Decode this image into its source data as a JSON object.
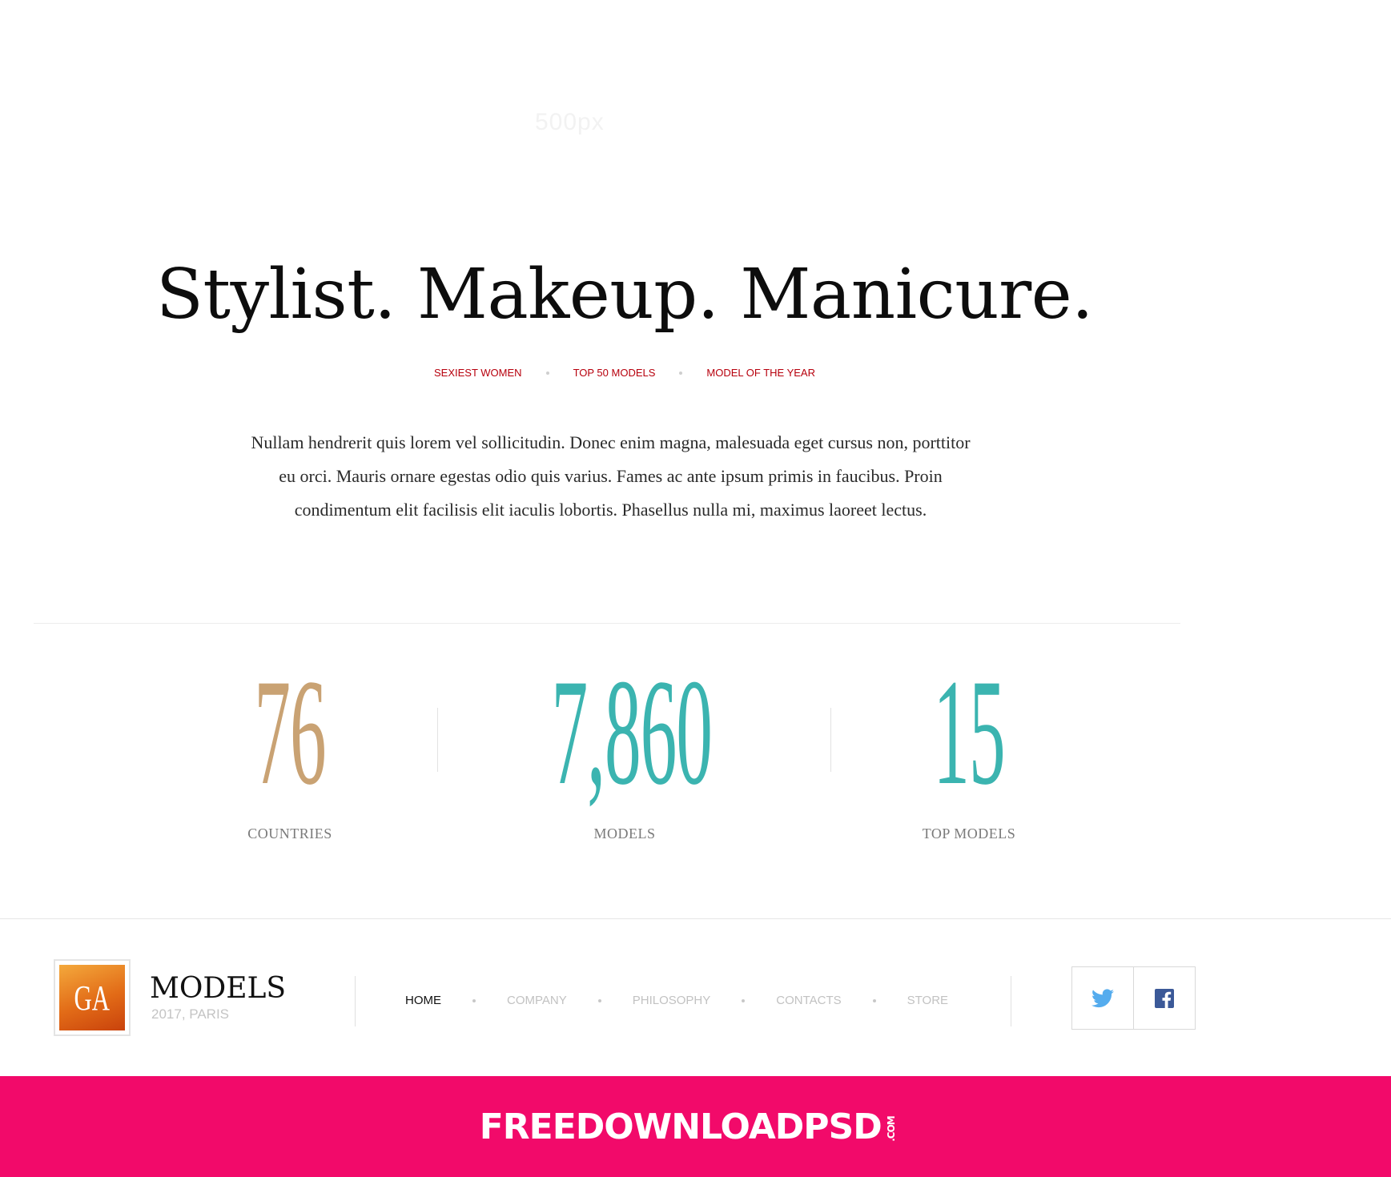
{
  "faint_logo": "500px",
  "hero": {
    "title": "Stylist. Makeup. Manicure."
  },
  "tags": [
    "SEXIEST WOMEN",
    "TOP 50 MODELS",
    "MODEL OF THE YEAR"
  ],
  "intro": "Nullam hendrerit quis lorem vel sollicitudin. Donec enim magna, malesuada eget cursus non, porttitor eu orci. Mauris ornare egestas odio quis varius. Fames ac ante ipsum primis in faucibus. Proin condimentum elit facilisis elit iaculis lobortis. Phasellus nulla mi, maximus laoreet lectus.",
  "stats": [
    {
      "number": "76",
      "label": "COUNTRIES",
      "color": "#c9a273"
    },
    {
      "number": "7,860",
      "label": "MODELS",
      "color": "#3bb4b0"
    },
    {
      "number": "15",
      "label": "TOP MODELS",
      "color": "#3bb4b0"
    }
  ],
  "footer": {
    "logo_text": "GA",
    "brand_name": "MODELS",
    "brand_sub": "2017, PARIS",
    "nav": [
      "HOME",
      "COMPANY",
      "PHILOSOPHY",
      "CONTACTS",
      "STORE"
    ],
    "active_nav": "HOME",
    "social": [
      "twitter-icon",
      "facebook-icon"
    ]
  },
  "banner": {
    "text": "FREEDOWNLOADPSD",
    "suffix": ".COM"
  },
  "colors": {
    "tag_red": "#b7000d",
    "banner_pink": "#f20a6a",
    "twitter_blue": "#55acee",
    "facebook_blue": "#3b5998"
  }
}
